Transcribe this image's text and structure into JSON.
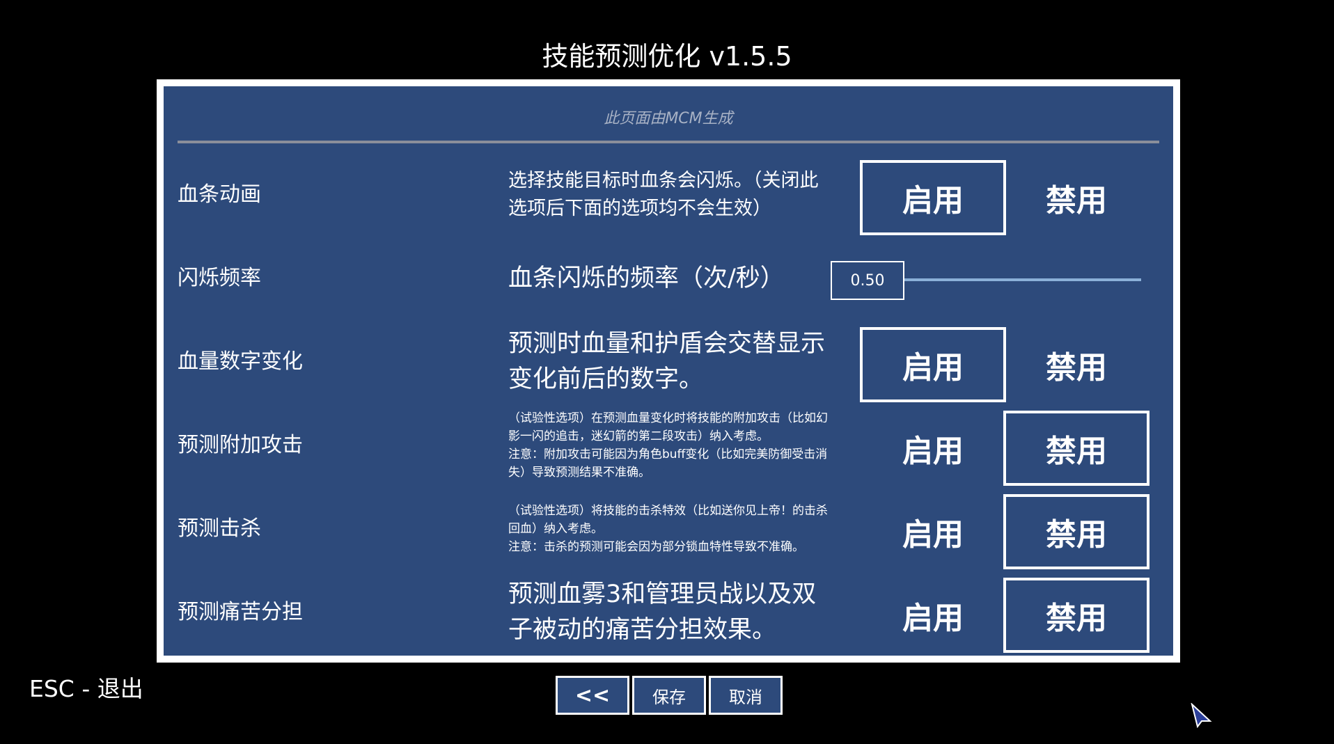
{
  "window": {
    "title": "技能预测优化  v1.5.5",
    "subtitle": "此页面由MCM生成"
  },
  "options": [
    {
      "label": "血条动画",
      "description": "选择技能目标时血条会闪烁。（关闭此选项后下面的选项均不会生效）",
      "enable_label": "启用",
      "disable_label": "禁用",
      "selected": "enable"
    },
    {
      "label": "闪烁频率",
      "description": "血条闪烁的频率（次/秒）",
      "slider_value_text": "0.50",
      "slider_value": 0.5
    },
    {
      "label": "血量数字变化",
      "description": "预测时血量和护盾会交替显示变化前后的数字。",
      "enable_label": "启用",
      "disable_label": "禁用",
      "selected": "enable"
    },
    {
      "label": "预测附加攻击",
      "description_lines": [
        "（试验性选项）在预测血量变化时将技能的附加攻击（比如幻影一闪的追击，迷幻箭的第二段攻击）纳入考虑。",
        "注意：附加攻击可能因为角色buff变化（比如完美防御受击消失）导致预测结果不准确。"
      ],
      "enable_label": "启用",
      "disable_label": "禁用",
      "selected": "disable"
    },
    {
      "label": "预测击杀",
      "description_lines": [
        "（试验性选项）将技能的击杀特效（比如送你见上帝！的击杀回血）纳入考虑。",
        "注意：击杀的预测可能会因为部分锁血特性导致不准确。"
      ],
      "enable_label": "启用",
      "disable_label": "禁用",
      "selected": "disable"
    },
    {
      "label": "预测痛苦分担",
      "description": "预测血雾3和管理员战以及双子被动的痛苦分担效果。",
      "enable_label": "启用",
      "disable_label": "禁用",
      "selected": "disable"
    }
  ],
  "footer": {
    "back_label": "<<",
    "save_label": "保存",
    "cancel_label": "取消",
    "esc_hint": "ESC - 退出"
  },
  "colors": {
    "panel_bg": "#2d4a7b",
    "panel_border": "#ffffff",
    "slider_track": "#8bb0d8",
    "page_bg": "#000000"
  }
}
